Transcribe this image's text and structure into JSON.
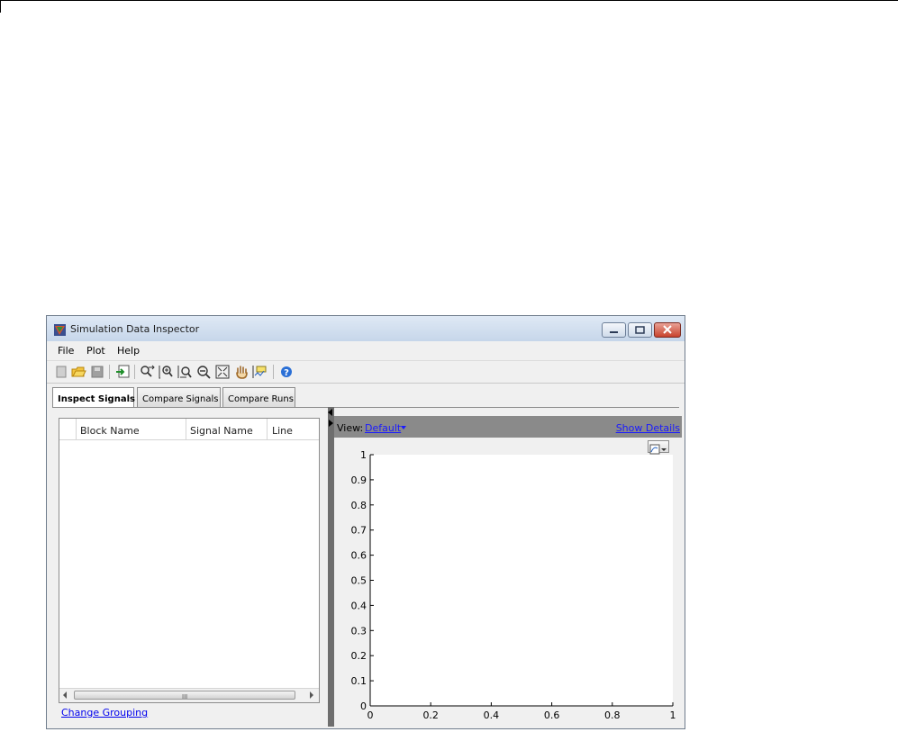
{
  "window": {
    "title": "Simulation Data Inspector",
    "controls": [
      "minimize",
      "maximize",
      "close"
    ]
  },
  "menu": [
    "File",
    "Plot",
    "Help"
  ],
  "toolbar": [
    "new-icon",
    "open-icon",
    "save-icon",
    "import-icon",
    "zoom-x-icon",
    "zoom-in-icon",
    "zoom-y-icon",
    "zoom-out-icon",
    "fit-to-view-icon",
    "pan-icon",
    "data-cursor-icon",
    "help-icon"
  ],
  "tabs": [
    "Inspect Signals",
    "Compare Signals",
    "Compare Runs"
  ],
  "signals_table": {
    "columns": [
      "Block Name",
      "Signal Name",
      "Line"
    ],
    "rows": [],
    "scroll_grip": "III"
  },
  "links": {
    "change_grouping": "Change Grouping",
    "show_details": "Show Details"
  },
  "view": {
    "label": "View:",
    "value": "Default"
  },
  "chart_data": {
    "type": "line",
    "series": [],
    "xlim": [
      0,
      1
    ],
    "ylim": [
      0,
      1
    ],
    "x_ticks": [
      "0",
      "0.2",
      "0.4",
      "0.6",
      "0.8",
      "1"
    ],
    "y_ticks": [
      "0",
      "0.1",
      "0.2",
      "0.3",
      "0.4",
      "0.5",
      "0.6",
      "0.7",
      "0.8",
      "0.9",
      "1"
    ],
    "grid": false,
    "legend": ""
  },
  "colors": {
    "link": "#1a1aff",
    "splitter": "#6e6e6e",
    "plot_header": "#8a8a8a",
    "axis": "#000000"
  }
}
